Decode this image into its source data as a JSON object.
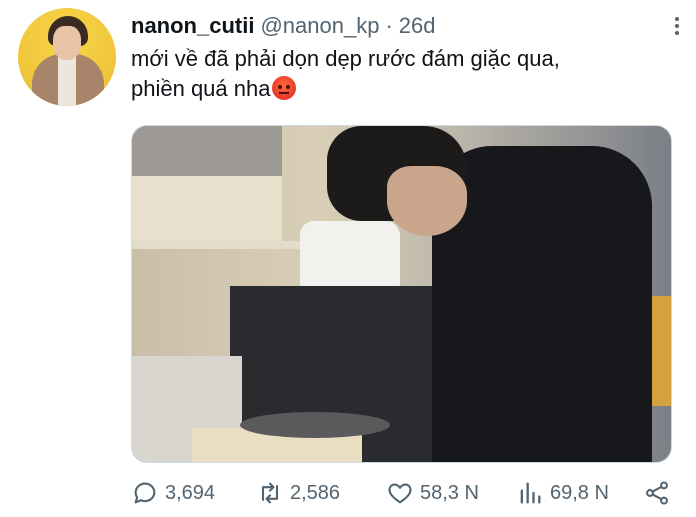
{
  "tweet": {
    "author": {
      "display_name": "nanon_cutii",
      "handle": "@nanon_kp",
      "avatar_icon": "profile-photo"
    },
    "separator": "·",
    "timestamp": "26d",
    "text_line1": "mới về đã phải dọn dẹp rước đám giặc qua,",
    "text_line2": "phiền quá nha",
    "emoji": "angry-face-icon",
    "media": {
      "type": "photo"
    },
    "stats": {
      "replies": "3,694",
      "retweets": "2,586",
      "likes": "58,3 N",
      "views": "69,8 N"
    }
  },
  "colors": {
    "text_primary": "#0f1419",
    "text_secondary": "#536471",
    "border": "#cfd9de",
    "background": "#ffffff"
  }
}
